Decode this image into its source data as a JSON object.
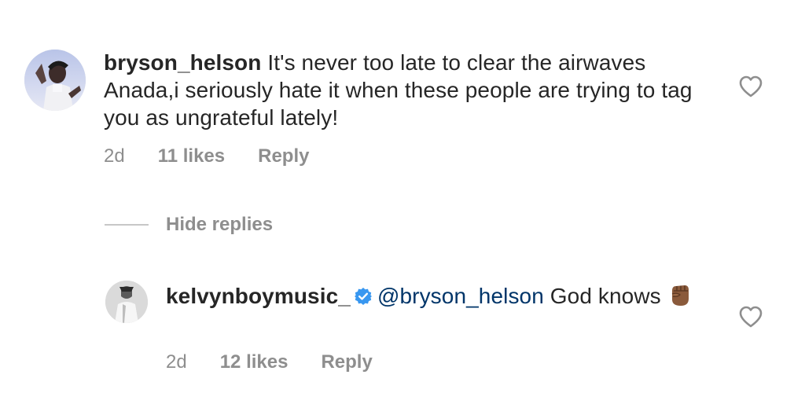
{
  "comment": {
    "username": "bryson_helson",
    "text": "It's never too late to clear the airwaves Anada,i seriously hate it when these people are trying to tag you as ungrateful lately!",
    "time": "2d",
    "likes": "11 likes",
    "reply": "Reply",
    "icons": {
      "avatar": "avatar-photo",
      "like": "heart-outline-icon"
    }
  },
  "hide_replies": {
    "label": "Hide replies"
  },
  "reply": {
    "username": "kelvynboymusic_",
    "verified": true,
    "mention": "@bryson_helson",
    "text": "God knows",
    "emoji": "raised-fist-medium-dark-skin-tone",
    "time": "2d",
    "likes": "12 likes",
    "reply": "Reply",
    "icons": {
      "avatar": "avatar-photo",
      "verified": "verified-badge-icon",
      "like": "heart-outline-icon"
    }
  },
  "colors": {
    "text": "#262626",
    "meta": "#8e8e8e",
    "mention": "#003569",
    "verified": "#3897f0",
    "divider": "#c7c7c7"
  }
}
